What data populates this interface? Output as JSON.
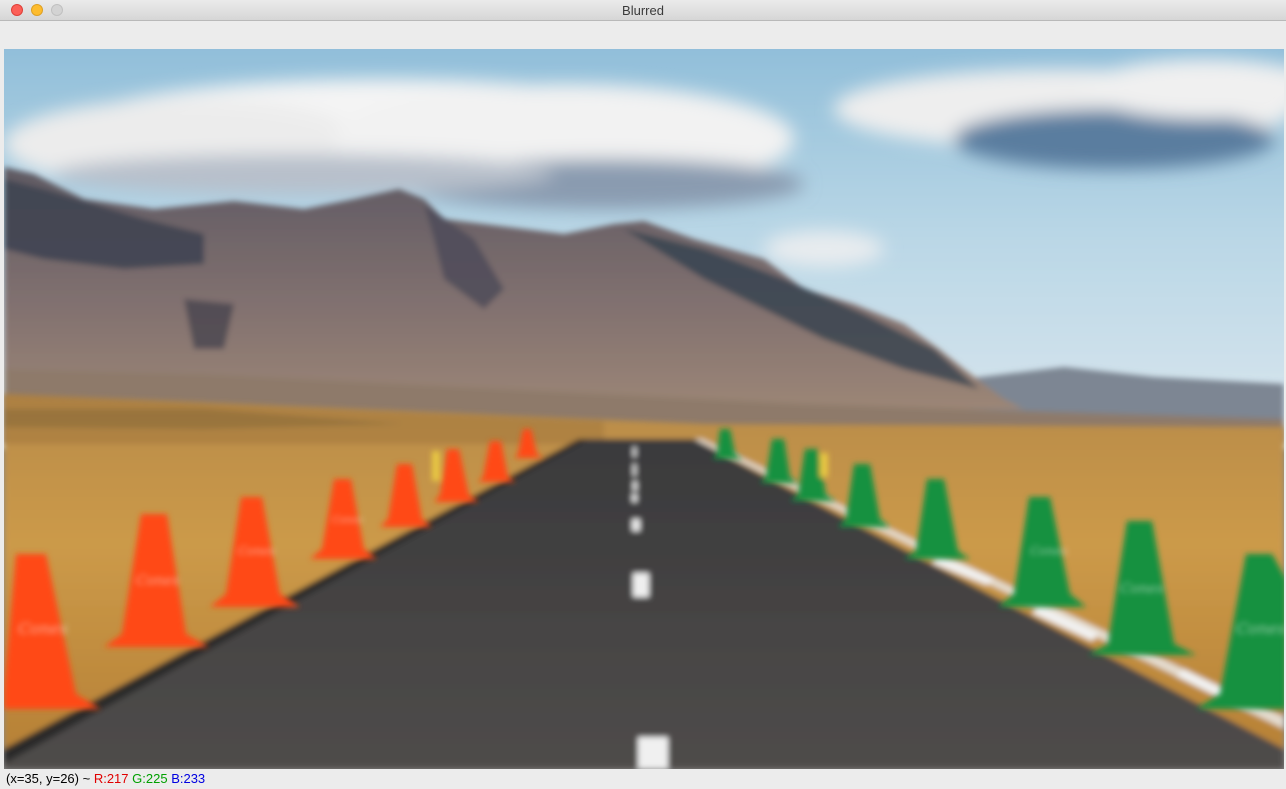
{
  "window": {
    "title": "Blurred"
  },
  "image": {
    "description_icon": "blurred-landscape-road-with-traffic-cones",
    "cone_colors": {
      "left": "#ff4a14",
      "right": "#15913f"
    },
    "cone_label": "Cones"
  },
  "status": {
    "coords": "(x=35, y=26) ~ ",
    "r": "R:217",
    "g": "G:225",
    "b": "B:233"
  }
}
